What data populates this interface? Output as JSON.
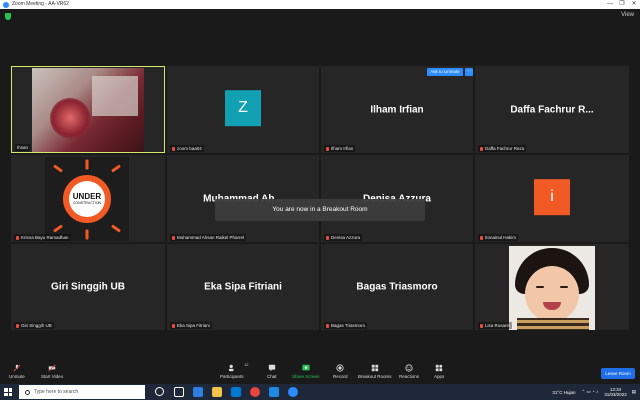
{
  "window": {
    "title": "Zoom Meeting - AA-VR62",
    "controls": [
      "—",
      "❐",
      "✕"
    ]
  },
  "view_label": "View",
  "tiles": [
    {
      "name": "Ihsan"
    },
    {
      "name": "zoom baa04",
      "avatar_letter": "Z"
    },
    {
      "name": "Ilham Irfian",
      "big": "Ilham Irfian"
    },
    {
      "name": "Daffa Fachrur Reza",
      "big": "Daffa Fachrur R..."
    },
    {
      "name": "Krisna Bayu Ramadhan"
    },
    {
      "name": "Muhammad Ahsan Raikel Pharrel",
      "big": "Muhammad  Ah..."
    },
    {
      "name": "Denisa Azzura",
      "big": "Denisa Azzura"
    },
    {
      "name": "Itonainul Hakim",
      "avatar_letter": "i"
    },
    {
      "name": "Giri Singgih UB",
      "big": "Giri Singgih UB"
    },
    {
      "name": "Eka Sipa Fitriani",
      "big": "Eka Sipa Fitriani"
    },
    {
      "name": "Bagas Triasmoro",
      "big": "Bagas Triasmoro"
    },
    {
      "name": "Lisa Rosanti"
    }
  ],
  "under_construction": {
    "line1": "UNDER",
    "line2": "CONSTRUCTION"
  },
  "ask_to_unmute": "Ask to Unmute",
  "more": "···",
  "toast": "You are now in a Breakout Room",
  "toolbar": {
    "unmute": "Unmute",
    "start_video": "Start Video",
    "participants": "Participants",
    "participants_count": "12",
    "chat": "Chat",
    "share_screen": "Share Screen",
    "record": "Record",
    "breakout_rooms": "Breakout Rooms",
    "reactions": "Reactions",
    "apps": "Apps",
    "leave_room": "Leave Room"
  },
  "taskbar": {
    "search_placeholder": "Type here to search",
    "weather": "31°C  Hujan",
    "time": "13:34",
    "date": "31/03/2022"
  }
}
